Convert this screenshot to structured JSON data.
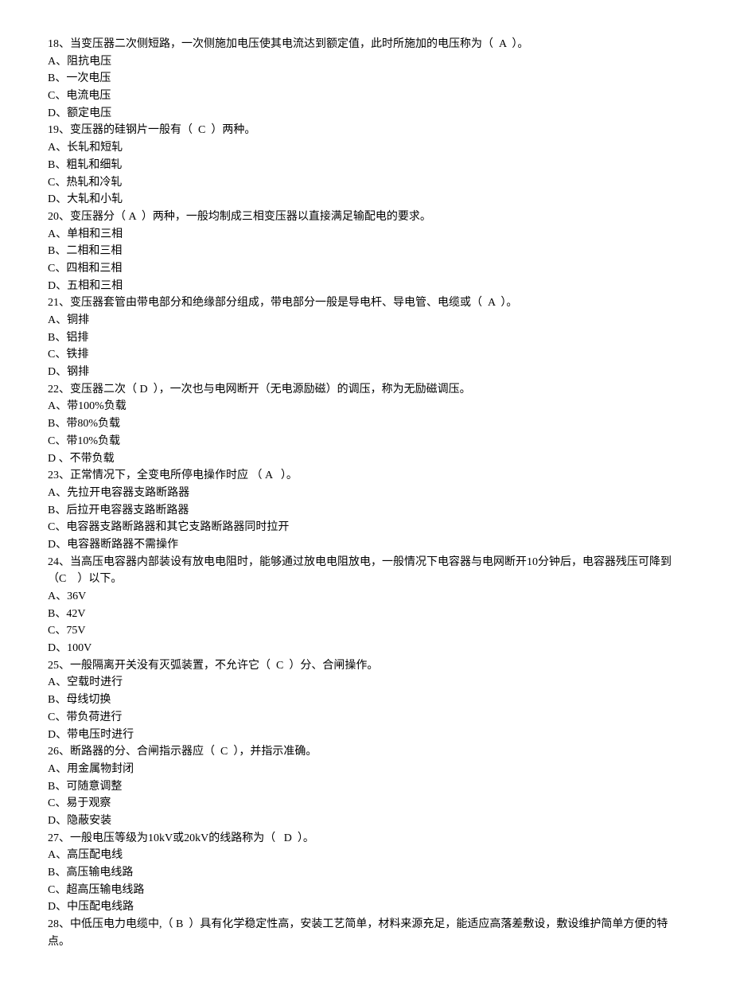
{
  "questions": [
    {
      "stem": "18、当变压器二次侧短路，一次侧施加电压使其电流达到额定值，此时所施加的电压称为（  A  ）。",
      "options": [
        "A、阻抗电压",
        "B、一次电压",
        "C、电流电压",
        "D、额定电压"
      ]
    },
    {
      "stem": "19、变压器的硅钢片一般有（  C  ）两种。",
      "options": [
        "A、长轧和短轧",
        "B、粗轧和细轧",
        "C、热轧和冷轧",
        "D、大轧和小轧"
      ]
    },
    {
      "stem": "20、变压器分（ A  ）两种，一般均制成三相变压器以直接满足输配电的要求。",
      "options": [
        "A、单相和三相",
        "B、二相和三相",
        "C、四相和三相",
        "D、五相和三相"
      ]
    },
    {
      "stem": "21、变压器套管由带电部分和绝缘部分组成，带电部分一般是导电杆、导电管、电缆或（  A  ）。",
      "options": [
        "A、铜排",
        "B、铝排",
        "C、铁排",
        "D、钢排"
      ]
    },
    {
      "stem": "22、变压器二次（ D  ），一次也与电网断开（无电源励磁）的调压，称为无励磁调压。",
      "options": [
        "A、带100%负载",
        "B、带80%负载",
        "C、带10%负载",
        "D 、不带负载"
      ]
    },
    {
      "stem": "23、正常情况下，全变电所停电操作时应 （ A   ）。",
      "options": [
        "A、先拉开电容器支路断路器",
        "B、后拉开电容器支路断路器",
        "C、电容器支路断路器和其它支路断路器同时拉开",
        "D、电容器断路器不需操作"
      ]
    },
    {
      "stem": "24、当高压电容器内部装设有放电电阻时，能够通过放电电阻放电，一般情况下电容器与电网断开10分钟后，电容器残压可降到（C    ）以下。",
      "options": [
        "A、36V",
        "B、42V",
        "C、75V",
        "D、100V"
      ]
    },
    {
      "stem": "25、一般隔离开关没有灭弧装置，不允许它（  C  ）分、合闸操作。",
      "options": [
        "A、空载时进行",
        "B、母线切换",
        "C、带负荷进行",
        "D、带电压时进行"
      ]
    },
    {
      "stem": "26、断路器的分、合闸指示器应（  C  ），并指示准确。",
      "options": [
        "A、用金属物封闭",
        "B、可随意调整",
        "C、易于观察",
        "D、隐蔽安装"
      ]
    },
    {
      "stem": "27、一般电压等级为10kV或20kV的线路称为（   D  ）。",
      "options": [
        "A、高压配电线",
        "B、高压输电线路",
        "C、超高压输电线路",
        "D、中压配电线路"
      ]
    },
    {
      "stem": "28、中低压电力电缆中,（ B  ）具有化学稳定性高，安装工艺简单，材料来源充足，能适应高落差敷设，敷设维护简单方便的特点。",
      "options": []
    }
  ]
}
